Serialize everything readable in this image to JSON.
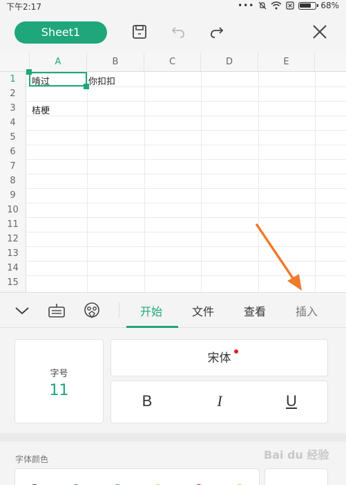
{
  "status": {
    "time": "下午2:17",
    "battery": "68%"
  },
  "toolbar": {
    "sheet_name": "Sheet1"
  },
  "sheet": {
    "columns": [
      "A",
      "B",
      "C",
      "D",
      "E"
    ],
    "rows": [
      "1",
      "2",
      "3",
      "4",
      "5",
      "6",
      "7",
      "8",
      "9",
      "10",
      "11",
      "12",
      "13",
      "14",
      "15"
    ],
    "cells": {
      "A1": "啃过",
      "B1": "你扣扣",
      "A3": "桔梗"
    }
  },
  "tabs": {
    "start": "开始",
    "file": "文件",
    "view": "查看",
    "insert": "插入"
  },
  "format": {
    "font_size_label": "字号",
    "font_size_value": "11",
    "font_name": "宋体",
    "bold": "B",
    "italic": "I",
    "underline": "U",
    "font_color_label": "字体颜色"
  },
  "colors": {
    "accent": "#1fa67a",
    "arrow": "#f07a2a",
    "swatches": [
      "#333333",
      "#2a8de0",
      "#3cb44b",
      "#f5c518",
      "#e02020",
      "#f5c518"
    ]
  },
  "watermark": "Bai du 经验"
}
